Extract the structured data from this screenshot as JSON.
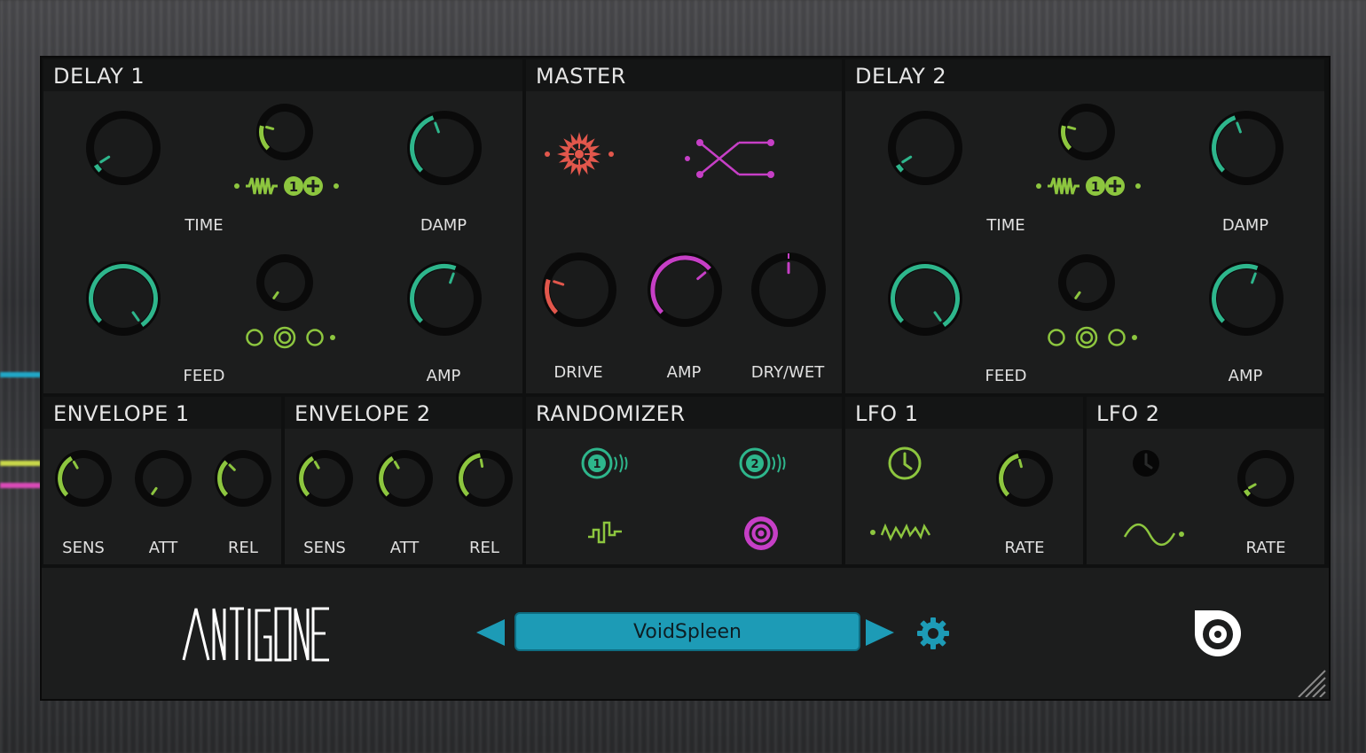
{
  "delay1": {
    "title": "DELAY 1",
    "time_label": "TIME",
    "damp_label": "DAMP",
    "feed_label": "FEED",
    "amp_label": "AMP"
  },
  "master": {
    "title": "MASTER",
    "drive_label": "DRIVE",
    "amp_label": "AMP",
    "drywet_label": "DRY/WET"
  },
  "delay2": {
    "title": "DELAY 2",
    "time_label": "TIME",
    "damp_label": "DAMP",
    "feed_label": "FEED",
    "amp_label": "AMP"
  },
  "envelope1": {
    "title": "ENVELOPE 1",
    "sens_label": "SENS",
    "att_label": "ATT",
    "rel_label": "REL"
  },
  "envelope2": {
    "title": "ENVELOPE 2",
    "sens_label": "SENS",
    "att_label": "ATT",
    "rel_label": "REL"
  },
  "randomizer": {
    "title": "RANDOMIZER",
    "source1_number": "1",
    "source2_number": "2"
  },
  "lfo1": {
    "title": "LFO 1",
    "rate_label": "RATE"
  },
  "lfo2": {
    "title": "LFO 2",
    "rate_label": "RATE"
  },
  "footer": {
    "logo_text": "ANTIGONE",
    "preset_name": "VoidSpleen",
    "prev_icon": "triangle-left-icon",
    "next_icon": "triangle-right-icon",
    "settings_icon": "gear-icon",
    "brand_icon": "brand-logo-icon"
  },
  "colors": {
    "teal": "#2eb68c",
    "lime": "#8dc63f",
    "magenta": "#c63fc6",
    "red": "#e2574c",
    "preset_blue": "#1d9bb6",
    "panel": "#1c1d1d"
  }
}
